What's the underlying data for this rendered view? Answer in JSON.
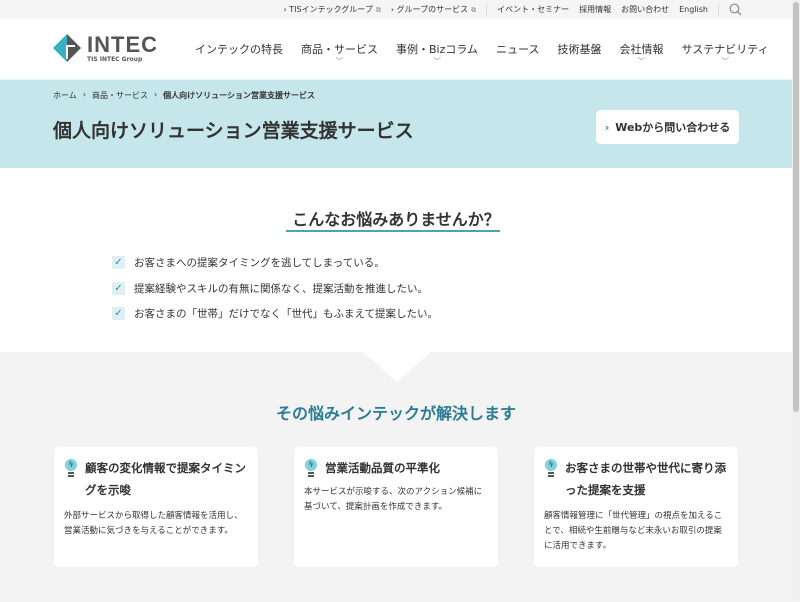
{
  "utility_nav": {
    "items": [
      {
        "label": "TISインテックグループ",
        "external": true
      },
      {
        "label": "グループのサービス",
        "external": true
      },
      {
        "label": "イベント・セミナー"
      },
      {
        "label": "採用情報"
      },
      {
        "label": "お問い合わせ"
      },
      {
        "label": "English"
      }
    ],
    "search_icon": "search-icon"
  },
  "logo": {
    "main": "INTEC",
    "sub": "TIS INTEC Group"
  },
  "nav": [
    {
      "label": "インテックの特長",
      "dropdown": false
    },
    {
      "label": "商品・サービス",
      "dropdown": true
    },
    {
      "label": "事例・Bizコラム",
      "dropdown": true
    },
    {
      "label": "ニュース",
      "dropdown": false
    },
    {
      "label": "技術基盤",
      "dropdown": false
    },
    {
      "label": "会社情報",
      "dropdown": true
    },
    {
      "label": "サステナビリティ",
      "dropdown": true
    }
  ],
  "breadcrumb": [
    "ホーム",
    "商品・サービス",
    "個人向けソリューション営業支援サービス"
  ],
  "hero": {
    "title": "個人向けソリューション営業支援サービス",
    "cta": "Webから問い合わせる"
  },
  "concerns": {
    "title": "こんなお悩みありませんか？",
    "items": [
      "お客さまへの提案タイミングを逃してしまっている。",
      "提案経験やスキルの有無に関係なく、提案活動を推進したい。",
      "お客さまの「世帯」だけでなく「世代」もふまえて提案したい。"
    ]
  },
  "solutions": {
    "title": "その悩みインテックが解決します",
    "cards": [
      {
        "title": "顧客の変化情報で提案タイミングを示唆",
        "body": "外部サービスから取得した顧客情報を活用し、営業活動に気づきを与えることができます。"
      },
      {
        "title": "営業活動品質の平準化",
        "body": "本サービスが示唆する、次のアクション候補に基づいて、提案計画を作成できます。"
      },
      {
        "title": "お客さまの世帯や世代に寄り添った提案を支援",
        "body": "顧客情報管理に「世代管理」の視点を加えることで、相続や生前贈与など末永いお取引の提案に活用できます。"
      }
    ]
  },
  "colors": {
    "accent": "#2a7c94",
    "hero_bg": "#c5e6ea"
  }
}
